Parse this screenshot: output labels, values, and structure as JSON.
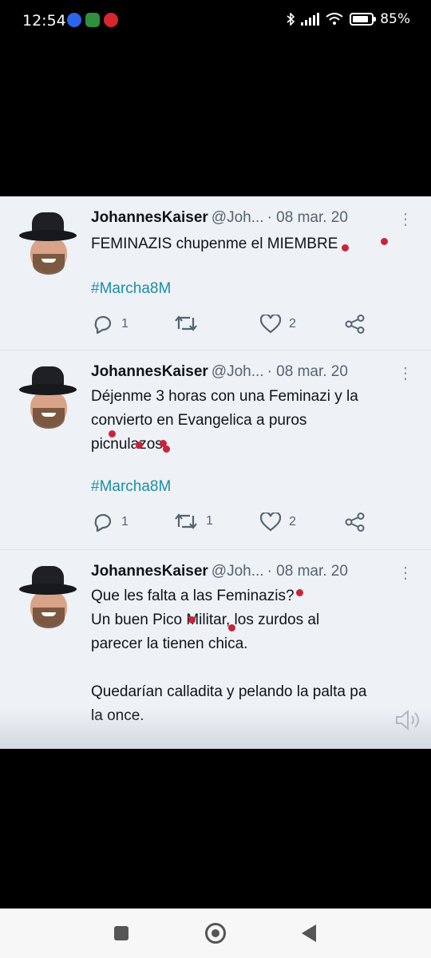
{
  "status_bar": {
    "time": "12:54",
    "battery": "85%",
    "battery_level": 0.85
  },
  "tweets": [
    {
      "name": "JohannesKaiser",
      "handle": "@Joh...",
      "date": "· 08 mar. 20",
      "lines": [
        "FEMINAZIS chupenme el MIEMBRE"
      ],
      "hashtag": "#Marcha8M",
      "replies": "1",
      "retweets": "",
      "likes": "2"
    },
    {
      "name": "JohannesKaiser",
      "handle": "@Joh...",
      "date": "· 08 mar. 20",
      "lines": [
        "Déjenme 3 horas con una Feminazi y la",
        "convierto en Evangelica a puros",
        "picnulazos"
      ],
      "hashtag": "#Marcha8M",
      "replies": "1",
      "retweets": "1",
      "likes": "2"
    },
    {
      "name": "JohannesKaiser",
      "handle": "@Joh...",
      "date": "· 08 mar. 20",
      "lines": [
        "Que les falta a las Feminazis?",
        "Un buen Pico Militar, los zurdos al",
        "parecer la tienen chica.",
        "",
        "Quedarían calladita y pelando la palta pa",
        "la once."
      ]
    }
  ],
  "icons": {
    "more": "more-icon",
    "reply": "reply-icon",
    "retweet": "retweet-icon",
    "like": "heart-icon",
    "share": "share-icon",
    "sound": "speaker-icon"
  },
  "colors": {
    "hashtag": "#1a8fa6",
    "background": "#eef1f6",
    "annotation": "#c8243b"
  }
}
